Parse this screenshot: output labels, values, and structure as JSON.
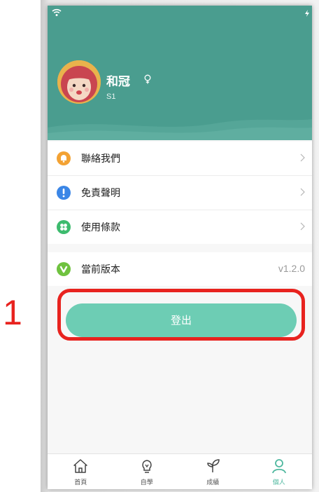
{
  "annotation": {
    "step": "1"
  },
  "colors": {
    "header": "#4a9d8f",
    "accent": "#6dcdb4",
    "annotation_red": "#e8231f",
    "active_tab": "#4fb89f"
  },
  "profile": {
    "name": "和冠",
    "gender_icon": "female-icon",
    "id": "S1"
  },
  "menu": {
    "items": [
      {
        "label": "聯絡我們",
        "icon": "bell-icon"
      },
      {
        "label": "免責聲明",
        "icon": "exclamation-icon"
      },
      {
        "label": "使用條款",
        "icon": "clover-icon"
      }
    ],
    "version": {
      "label": "當前版本",
      "value": "v1.2.0",
      "icon": "version-v-icon"
    }
  },
  "logout": {
    "label": "登出"
  },
  "tabbar": {
    "tabs": [
      {
        "label": "首頁",
        "icon": "home-icon"
      },
      {
        "label": "自學",
        "icon": "lightbulb-icon"
      },
      {
        "label": "成績",
        "icon": "sprout-icon"
      },
      {
        "label": "個人",
        "icon": "person-icon",
        "active": true
      }
    ]
  }
}
